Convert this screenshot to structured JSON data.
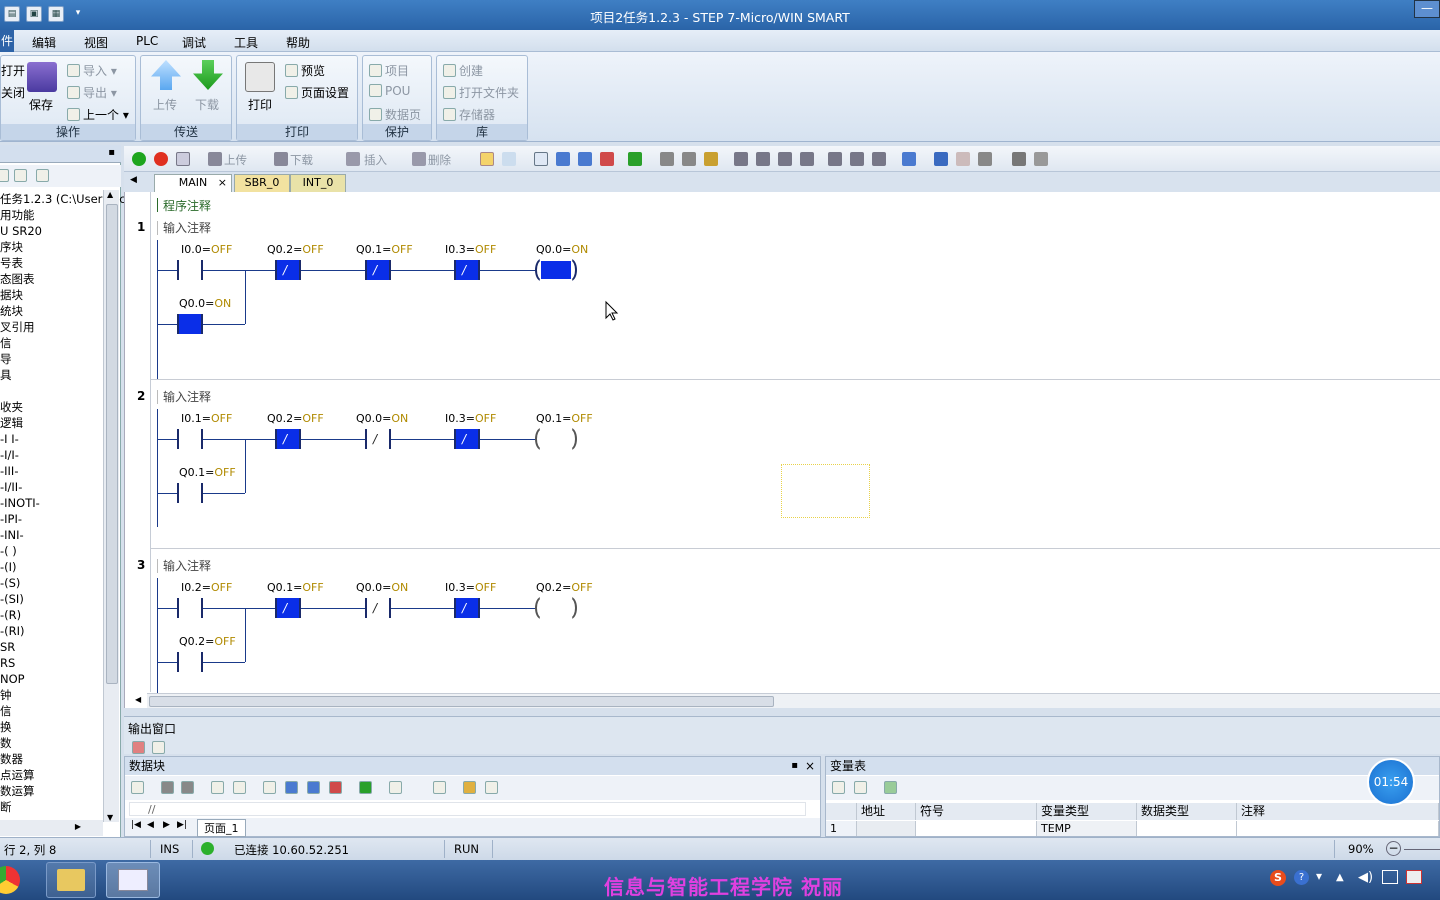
{
  "window": {
    "title": "项目2任务1.2.3 - STEP 7-Micro/WIN SMART"
  },
  "menu": {
    "file": "件",
    "items": [
      "编辑",
      "视图",
      "PLC",
      "调试",
      "工具",
      "帮助"
    ]
  },
  "ribbon": {
    "groups": {
      "ops": "操作",
      "transfer": "传送",
      "print": "打印",
      "protect": "保护",
      "lib": "库"
    },
    "open": "打开",
    "close": "关闭",
    "save": "保存",
    "import": "导入",
    "export": "导出",
    "prev": "上一个",
    "upload": "上传",
    "download": "下载",
    "print_btn": "打印",
    "preview": "预览",
    "page_setup": "页面设置",
    "project": "项目",
    "pou": "POU",
    "datapage": "数据页",
    "create": "创建",
    "open_folder": "打开文件夹",
    "storage": "存储器"
  },
  "tree": {
    "items": [
      "任务1.2.3 (C:\\Users\\ac",
      "用功能",
      "U SR20",
      "序块",
      "号表",
      "态图表",
      "据块",
      "统块",
      "叉引用",
      "信",
      "导",
      "具",
      "",
      "收夹",
      "逻辑",
      "-I I-",
      "-I/I-",
      "-III-",
      "-I/II-",
      "-INOTI-",
      "-IPI-",
      "-INI-",
      "-( )",
      "-(I)",
      "-(S)",
      "-(SI)",
      "-(R)",
      "-(RI)",
      "SR",
      "RS",
      "NOP",
      "钟",
      "信",
      "换",
      "数",
      "数器",
      "点运算",
      "数运算",
      "断"
    ]
  },
  "editor_toolbar": {
    "upload": "上传",
    "download": "下载",
    "insert": "插入",
    "delete": "删除"
  },
  "tabs": [
    {
      "label": "MAIN",
      "close": "×"
    },
    {
      "label": "SBR_0"
    },
    {
      "label": "INT_0"
    }
  ],
  "ladder": {
    "program_comment": "程序注释",
    "networks": [
      {
        "num": "1",
        "comment": "输入注释",
        "labels": [
          {
            "op": "I0.0=",
            "st": "OFF"
          },
          {
            "op": "Q0.2=",
            "st": "OFF"
          },
          {
            "op": "Q0.1=",
            "st": "OFF"
          },
          {
            "op": "I0.3=",
            "st": "OFF"
          },
          {
            "op": "Q0.0=",
            "st": "ON"
          },
          {
            "op": "Q0.0=",
            "st": "ON"
          }
        ]
      },
      {
        "num": "2",
        "comment": "输入注释",
        "labels": [
          {
            "op": "I0.1=",
            "st": "OFF"
          },
          {
            "op": "Q0.2=",
            "st": "OFF"
          },
          {
            "op": "Q0.0=",
            "st": "ON"
          },
          {
            "op": "I0.3=",
            "st": "OFF"
          },
          {
            "op": "Q0.1=",
            "st": "OFF"
          },
          {
            "op": "Q0.1=",
            "st": "OFF"
          }
        ]
      },
      {
        "num": "3",
        "comment": "输入注释",
        "labels": [
          {
            "op": "I0.2=",
            "st": "OFF"
          },
          {
            "op": "Q0.1=",
            "st": "OFF"
          },
          {
            "op": "Q0.0=",
            "st": "ON"
          },
          {
            "op": "I0.3=",
            "st": "OFF"
          },
          {
            "op": "Q0.2=",
            "st": "OFF"
          },
          {
            "op": "Q0.2=",
            "st": "OFF"
          }
        ]
      }
    ],
    "contact_slash": "/"
  },
  "output": {
    "title": "输出窗口"
  },
  "datablock": {
    "title": "数据块",
    "editor_text": "//",
    "page_tab": "页面_1"
  },
  "vartable": {
    "title": "变量表",
    "headers": [
      "地址",
      "符号",
      "变量类型",
      "数据类型",
      "注释"
    ],
    "row": {
      "num": "1",
      "type": "TEMP"
    }
  },
  "status": {
    "position": "行 2, 列 8",
    "mode": "INS",
    "connection": "已连接 10.60.52.251",
    "run": "RUN",
    "zoom": "90%"
  },
  "timer": "01:54",
  "watermark": "信息与智能工程学院 祝丽",
  "colors": {
    "active_contact": "#0a2ee8",
    "state_value": "#b08a00",
    "taskbar": "#2c5592"
  }
}
